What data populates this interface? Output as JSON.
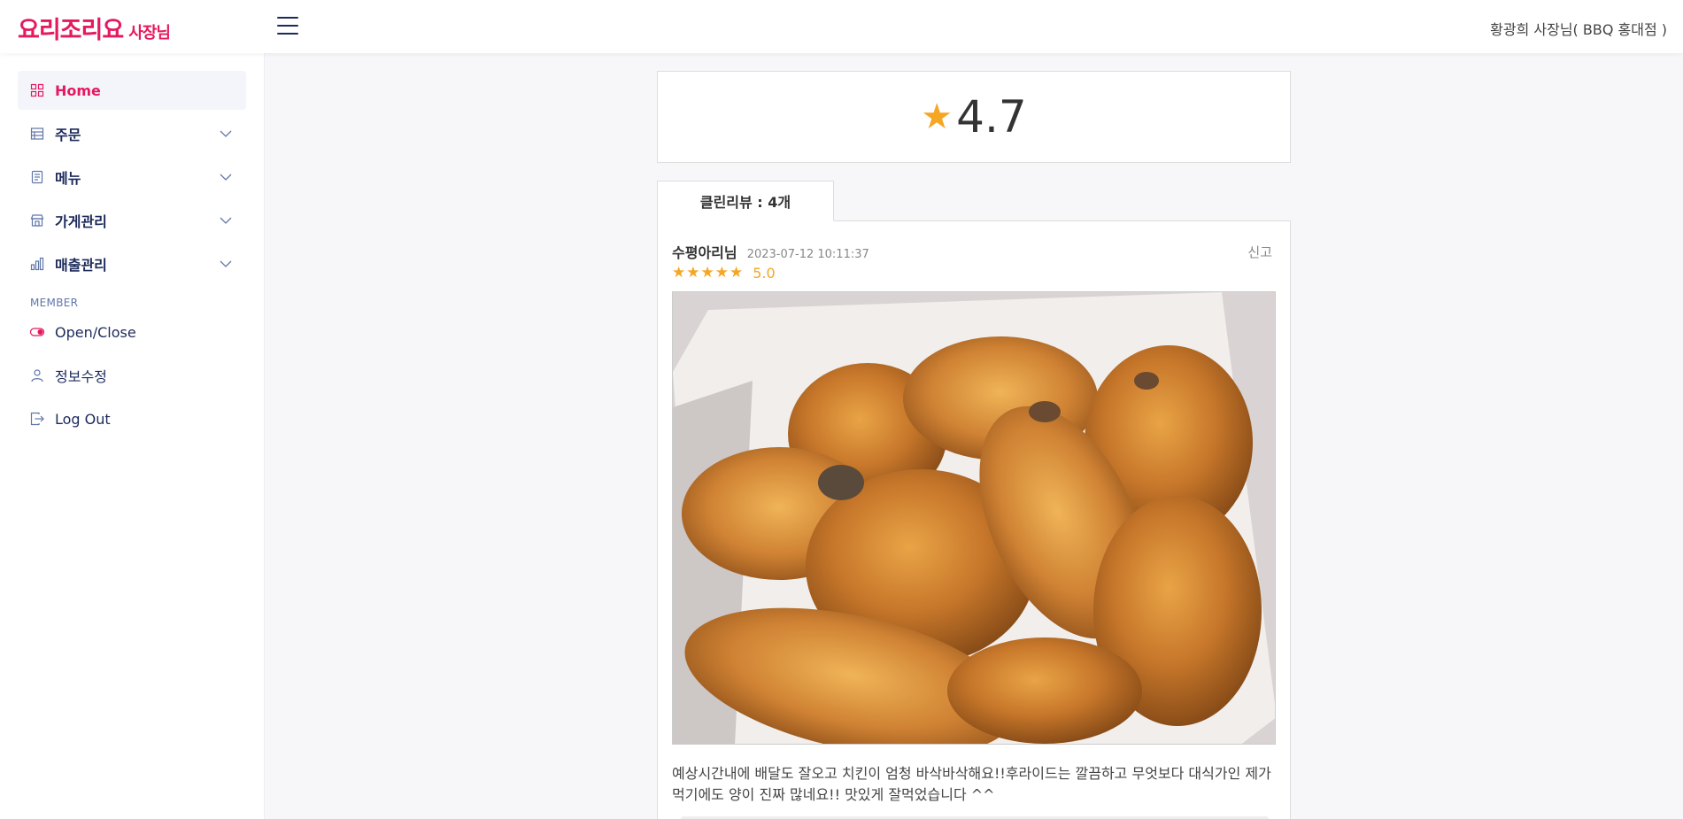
{
  "header": {
    "logo_main": "요리조리요",
    "logo_sub": "사장님",
    "user_label": "황광희 사장님( BBQ 홍대점 )"
  },
  "sidebar": {
    "items": [
      {
        "label": "Home",
        "icon": "grid-icon",
        "active": true
      },
      {
        "label": "주문",
        "icon": "order-icon",
        "expandable": true
      },
      {
        "label": "메뉴",
        "icon": "menu-icon",
        "expandable": true
      },
      {
        "label": "가게관리",
        "icon": "store-icon",
        "expandable": true
      },
      {
        "label": "매출관리",
        "icon": "bar-chart-icon",
        "expandable": true
      }
    ],
    "member_heading": "MEMBER",
    "member_items": [
      {
        "label": "Open/Close",
        "icon": "toggle-icon"
      },
      {
        "label": "정보수정",
        "icon": "user-icon"
      },
      {
        "label": "Log Out",
        "icon": "logout-icon"
      }
    ]
  },
  "rating": {
    "star": "★",
    "value": "4.7"
  },
  "review_tab": {
    "label": "클린리뷰 : 4개"
  },
  "review": {
    "reviewer": "수평아리님",
    "date": "2023-07-12 10:11:37",
    "stars": "★★★★★",
    "score": "5.0",
    "report": "신고",
    "text": "예상시간내에 배달도 잘오고 치킨이 엄청 바삭바삭해요!!후라이드는 깔끔하고 무엇보다 대식가인 제가 먹기에도 양이 진짜 많네요!! 맛있게 잘먹었습니다 ^^"
  },
  "colors": {
    "brand": "#e5195f",
    "navy": "#1c2a5c",
    "star": "#f5a623"
  }
}
